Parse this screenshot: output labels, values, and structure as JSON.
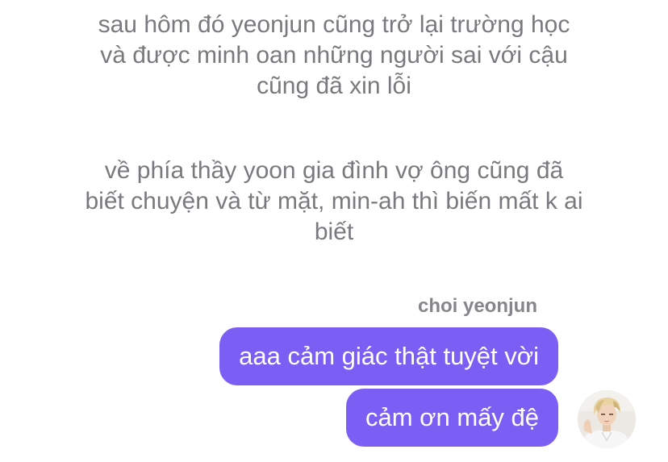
{
  "story": {
    "paragraph_1": "sau hôm đó yeonjun cũng trở lại trường học và được minh oan những người sai với cậu cũng đã xin lỗi",
    "paragraph_2": "về phía thầy yoon gia đình vợ ông cũng đã biết chuyện và từ mặt, min-ah thì biến mất k ai biết"
  },
  "chat": {
    "sender_name": "choi yeonjun",
    "messages": [
      {
        "text": "aaa cảm giác thật tuyệt vời"
      },
      {
        "text": "cảm ơn mấy đệ"
      }
    ],
    "avatar_icon": "user-avatar-photo",
    "bubble_color": "#7b5ef3"
  }
}
